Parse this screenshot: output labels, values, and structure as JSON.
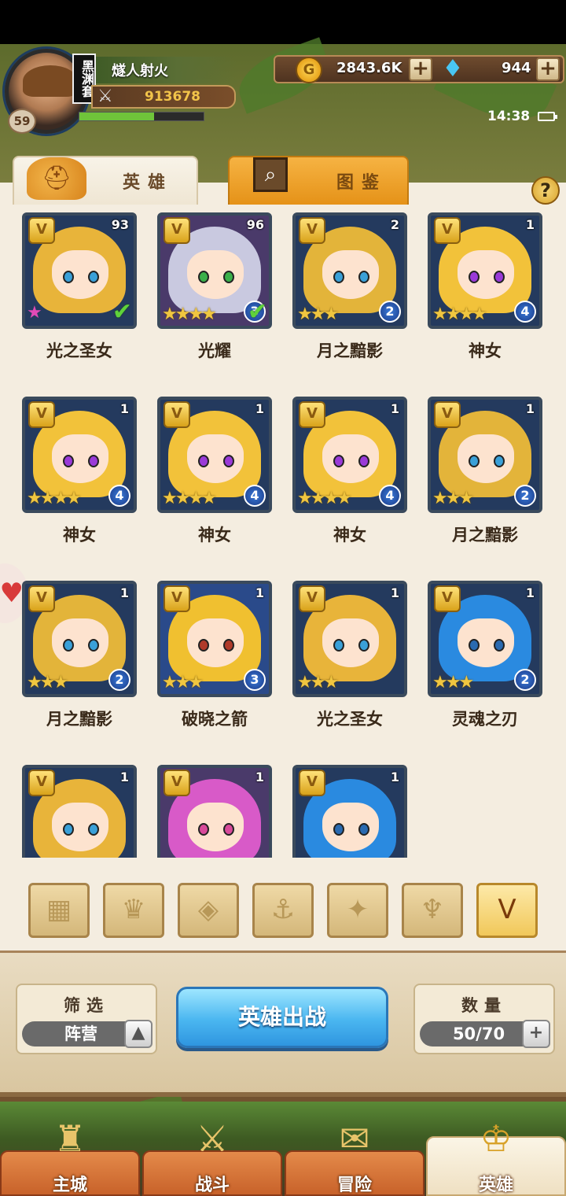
{
  "player": {
    "name": "燧人射火",
    "level": "59",
    "guild_badge": "黑渊套",
    "power": "913678",
    "exp_fraction": 0.6
  },
  "resources": {
    "gold": "2843.6K",
    "gems": "944",
    "plus": "+"
  },
  "status": {
    "time": "14:38"
  },
  "tabs": {
    "heroes": "英雄",
    "codex": "图鉴",
    "help": "?"
  },
  "heroes": [
    {
      "name": "光之圣女",
      "level": "93",
      "stars": 1,
      "rank": "",
      "deployed": true,
      "hair": "#e8b43a",
      "eye": "#3aa0d8",
      "bg": "default"
    },
    {
      "name": "光耀",
      "level": "96",
      "stars": 4,
      "rank": "3",
      "deployed": true,
      "hair": "#c9c9e0",
      "eye": "#3ab04a",
      "bg": "purple"
    },
    {
      "name": "月之黯影",
      "level": "2",
      "stars": 3,
      "rank": "2",
      "deployed": false,
      "hair": "#e3b43a",
      "eye": "#3aa0d8",
      "bg": "default"
    },
    {
      "name": "神女",
      "level": "1",
      "stars": 4,
      "rank": "4",
      "deployed": false,
      "hair": "#f2c23a",
      "eye": "#9a3ad8",
      "bg": "default"
    },
    {
      "name": "神女",
      "level": "1",
      "stars": 4,
      "rank": "4",
      "deployed": false,
      "hair": "#f2c23a",
      "eye": "#9a3ad8",
      "bg": "default"
    },
    {
      "name": "神女",
      "level": "1",
      "stars": 4,
      "rank": "4",
      "deployed": false,
      "hair": "#f2c23a",
      "eye": "#9a3ad8",
      "bg": "default"
    },
    {
      "name": "神女",
      "level": "1",
      "stars": 4,
      "rank": "4",
      "deployed": false,
      "hair": "#f2c23a",
      "eye": "#9a3ad8",
      "bg": "default"
    },
    {
      "name": "月之黯影",
      "level": "1",
      "stars": 3,
      "rank": "2",
      "deployed": false,
      "hair": "#e3b43a",
      "eye": "#3aa0d8",
      "bg": "default"
    },
    {
      "name": "月之黯影",
      "level": "1",
      "stars": 3,
      "rank": "2",
      "deployed": false,
      "hair": "#e3b43a",
      "eye": "#3aa0d8",
      "bg": "default"
    },
    {
      "name": "破晓之箭",
      "level": "1",
      "stars": 3,
      "rank": "3",
      "deployed": false,
      "hair": "#f0c030",
      "eye": "#b03a2a",
      "bg": "blue"
    },
    {
      "name": "光之圣女",
      "level": "1",
      "stars": 3,
      "rank": "",
      "deployed": false,
      "hair": "#e8b43a",
      "eye": "#3aa0d8",
      "bg": "default"
    },
    {
      "name": "灵魂之刃",
      "level": "1",
      "stars": 3,
      "rank": "2",
      "deployed": false,
      "hair": "#2a8ae0",
      "eye": "#2a6ab0",
      "bg": "default"
    },
    {
      "name": "",
      "level": "1",
      "stars": 0,
      "rank": "",
      "deployed": false,
      "hair": "#e8b43a",
      "eye": "#3aa0d8",
      "bg": "default"
    },
    {
      "name": "",
      "level": "1",
      "stars": 0,
      "rank": "",
      "deployed": false,
      "hair": "#d85ac8",
      "eye": "#d84a9a",
      "bg": "purple"
    },
    {
      "name": "",
      "level": "1",
      "stars": 0,
      "rank": "",
      "deployed": false,
      "hair": "#2a8ae0",
      "eye": "#2a6ab0",
      "bg": "default"
    }
  ],
  "filters": [
    {
      "icon": "grid-icon",
      "glyph": "▦",
      "active": false
    },
    {
      "icon": "crown-icon",
      "glyph": "♛",
      "active": false
    },
    {
      "icon": "diamond-emblem-icon",
      "glyph": "◈",
      "active": false
    },
    {
      "icon": "anchor-icon",
      "glyph": "⚓",
      "active": false
    },
    {
      "icon": "beast-icon",
      "glyph": "✦",
      "active": false
    },
    {
      "icon": "horned-icon",
      "glyph": "♆",
      "active": false
    },
    {
      "icon": "chevron-emblem-icon",
      "glyph": "V",
      "active": true
    }
  ],
  "controls": {
    "filter_label": "筛选",
    "filter_value": "阵营",
    "deploy_label": "英雄出战",
    "count_label": "数量",
    "count_value": "50/70"
  },
  "nav": [
    {
      "label": "主城",
      "icon": "castle-icon",
      "glyph": "♜",
      "active": false
    },
    {
      "label": "战斗",
      "icon": "crossed-swords-icon",
      "glyph": "⚔",
      "active": false
    },
    {
      "label": "冒险",
      "icon": "scroll-map-icon",
      "glyph": "✉",
      "active": false
    },
    {
      "label": "英雄",
      "icon": "hero-crest-icon",
      "glyph": "♔",
      "active": true
    }
  ]
}
